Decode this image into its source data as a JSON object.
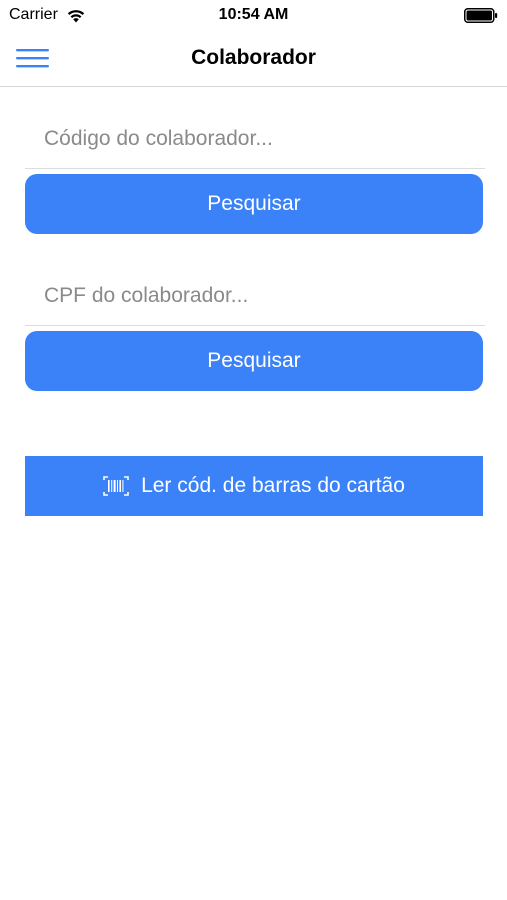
{
  "status_bar": {
    "carrier": "Carrier",
    "time": "10:54 AM",
    "wifi_icon": "wifi-icon",
    "battery_icon": "battery-full-icon"
  },
  "nav": {
    "title": "Colaborador",
    "menu_icon": "hamburger-menu-icon"
  },
  "search_code": {
    "placeholder": "Código do colaborador...",
    "value": "",
    "button_label": "Pesquisar"
  },
  "search_cpf": {
    "placeholder": "CPF do colaborador...",
    "value": "",
    "button_label": "Pesquisar"
  },
  "barcode": {
    "button_label": "Ler cód. de barras do cartão",
    "icon": "barcode-icon"
  },
  "colors": {
    "accent": "#3b82f8",
    "menu_icon": "#3b82f8",
    "divider": "#dcdcdc"
  }
}
